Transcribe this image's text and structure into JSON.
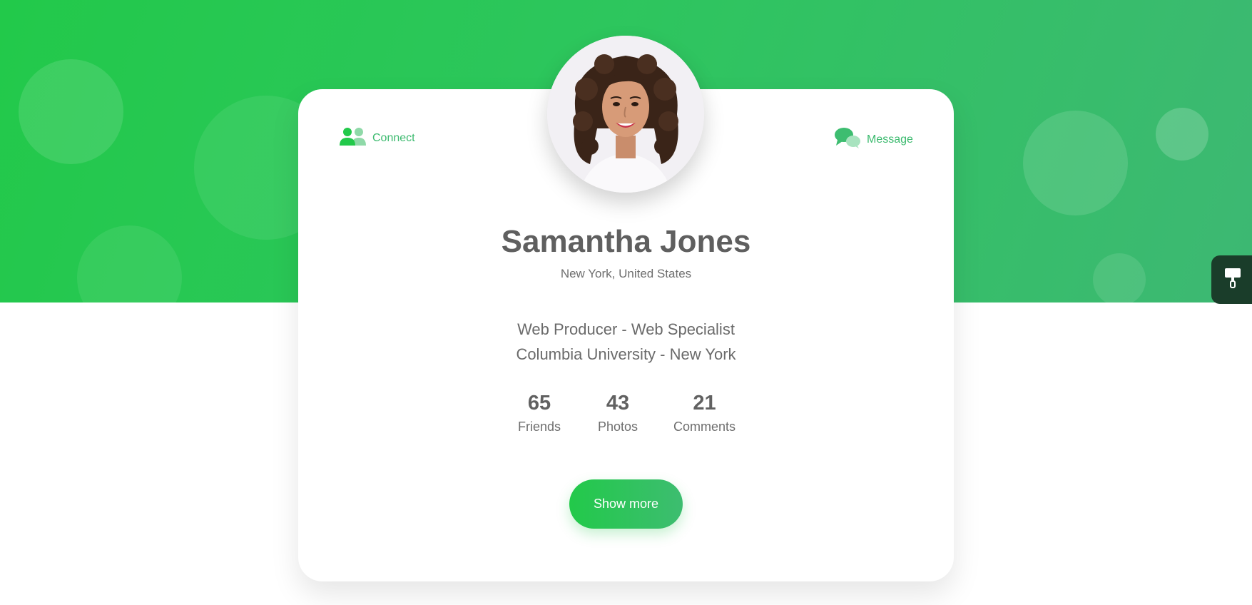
{
  "profile": {
    "name": "Samantha Jones",
    "location": "New York, United States",
    "bio_line_1": "Web Producer - Web Specialist",
    "bio_line_2": "Columbia University - New York"
  },
  "actions": {
    "connect_label": "Connect",
    "message_label": "Message",
    "show_more_label": "Show more"
  },
  "stats": [
    {
      "value": "65",
      "label": "Friends"
    },
    {
      "value": "43",
      "label": "Photos"
    },
    {
      "value": "21",
      "label": "Comments"
    }
  ],
  "icons": {
    "connect": "users-icon",
    "message": "chat-bubbles-icon",
    "side_tab": "paint-roller-icon"
  },
  "colors": {
    "accent": "#22c94a",
    "accent_2": "#3dbd70",
    "text_dark": "#5f5f5f",
    "side_tab": "#1a3d2a"
  }
}
